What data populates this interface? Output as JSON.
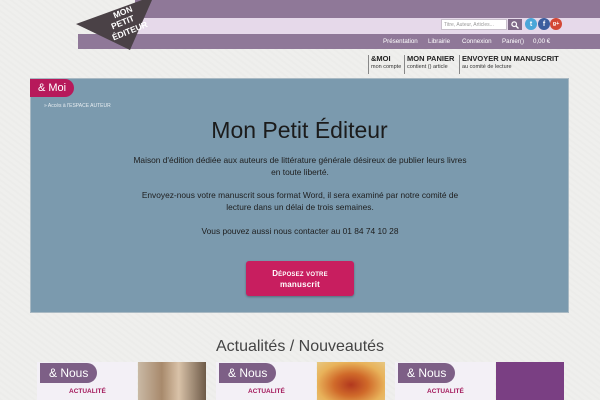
{
  "logo": {
    "lines": [
      "MON",
      "PETIT",
      "ÉDITEUR"
    ]
  },
  "search": {
    "placeholder": "Titre, Auteur, Articles..."
  },
  "social": [
    "t",
    "f",
    "g+"
  ],
  "nav": {
    "items": [
      "Présentation",
      "Librairie",
      "Connexion",
      "Panier()",
      "0,00 €"
    ]
  },
  "account": {
    "moi": {
      "title": "&MOI",
      "sub": "mon compte"
    },
    "panier": {
      "title": "MON PANIER",
      "sub": "contient () article"
    },
    "envoyer": {
      "title": "ENVOYER UN MANUSCRIT",
      "sub": "au comité de lecture"
    }
  },
  "hero": {
    "tag": "& Moi",
    "breadcrumb": "» Accès à l'ESPACE AUTEUR",
    "title": "Mon Petit Éditeur",
    "para1_line1": "Maison d'édition dédiée aux auteurs de littérature générale désireux de publier leurs livres",
    "para1_line2": "en toute liberté.",
    "para2_line1": "Envoyez-nous votre manuscrit sous format Word, il sera examiné par notre comité de",
    "para2_line2": "lecture dans un délai de trois semaines.",
    "para3": "Vous pouvez aussi nous contacter au 01 84 74 10 28",
    "cta_line1": "Déposez votre",
    "cta_line2": "manuscrit"
  },
  "news": {
    "title": "Actualités / Nouveautés",
    "cards": [
      {
        "tag": "& Nous",
        "kind": "ACTUALITÉ"
      },
      {
        "tag": "& Nous",
        "kind": "ACTUALITÉ"
      },
      {
        "tag": "& Nous",
        "kind": "ACTUALITÉ"
      }
    ]
  },
  "colors": {
    "purple": "#8f7898",
    "panel": "#7b9aae",
    "accent": "#c81e5f"
  }
}
